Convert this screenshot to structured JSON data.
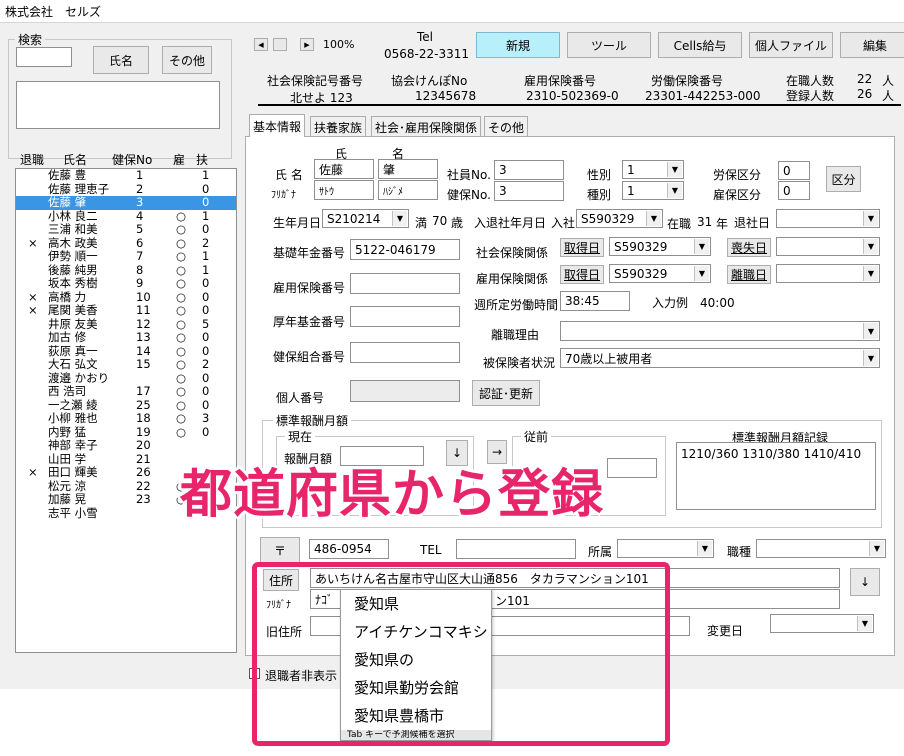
{
  "app_title": "株式会社　セルズ",
  "search": {
    "group_label": "検索",
    "name_button": "氏名",
    "other_button": "その他"
  },
  "list": {
    "headers": {
      "retired": "退職",
      "name": "氏名",
      "insurance_no": "健保No",
      "employed": "雇",
      "dependents": "扶"
    },
    "rows": [
      {
        "retired": "",
        "name": "佐藤 豊",
        "no": "1",
        "emp": "",
        "dep": "1"
      },
      {
        "retired": "",
        "name": "佐藤 理恵子",
        "no": "2",
        "emp": "",
        "dep": "0"
      },
      {
        "retired": "",
        "name": "佐藤 肇",
        "no": "3",
        "emp": "",
        "dep": "0",
        "selected": true
      },
      {
        "retired": "",
        "name": "小林 良二",
        "no": "4",
        "emp": "○",
        "dep": "1"
      },
      {
        "retired": "",
        "name": "三浦 和美",
        "no": "5",
        "emp": "○",
        "dep": "0"
      },
      {
        "retired": "×",
        "name": "高木 政美",
        "no": "6",
        "emp": "○",
        "dep": "2"
      },
      {
        "retired": "",
        "name": "伊勢 順一",
        "no": "7",
        "emp": "○",
        "dep": "1"
      },
      {
        "retired": "",
        "name": "後藤 純男",
        "no": "8",
        "emp": "○",
        "dep": "1"
      },
      {
        "retired": "",
        "name": "坂本 秀樹",
        "no": "9",
        "emp": "○",
        "dep": "0"
      },
      {
        "retired": "×",
        "name": "高橋 力",
        "no": "10",
        "emp": "○",
        "dep": "0"
      },
      {
        "retired": "×",
        "name": "尾関 美香",
        "no": "11",
        "emp": "○",
        "dep": "0"
      },
      {
        "retired": "",
        "name": "井原 友美",
        "no": "12",
        "emp": "○",
        "dep": "5"
      },
      {
        "retired": "",
        "name": "加古 修",
        "no": "13",
        "emp": "○",
        "dep": "0"
      },
      {
        "retired": "",
        "name": "荻原 真一",
        "no": "14",
        "emp": "○",
        "dep": "0"
      },
      {
        "retired": "",
        "name": "大石 弘文",
        "no": "15",
        "emp": "○",
        "dep": "2"
      },
      {
        "retired": "",
        "name": "渡邉 かおり",
        "no": "",
        "emp": "○",
        "dep": "0"
      },
      {
        "retired": "",
        "name": "西 浩司",
        "no": "17",
        "emp": "○",
        "dep": "0"
      },
      {
        "retired": "",
        "name": "一之瀬 綾",
        "no": "25",
        "emp": "○",
        "dep": "0"
      },
      {
        "retired": "",
        "name": "小柳 雅也",
        "no": "18",
        "emp": "○",
        "dep": "3"
      },
      {
        "retired": "",
        "name": "内野 猛",
        "no": "19",
        "emp": "○",
        "dep": "0"
      },
      {
        "retired": "",
        "name": "神部 幸子",
        "no": "20",
        "emp": "",
        "dep": ""
      },
      {
        "retired": "",
        "name": "山田 学",
        "no": "21",
        "emp": "",
        "dep": ""
      },
      {
        "retired": "×",
        "name": "田口 輝美",
        "no": "26",
        "emp": "",
        "dep": ""
      },
      {
        "retired": "",
        "name": "松元 涼",
        "no": "22",
        "emp": "○",
        "dep": ""
      },
      {
        "retired": "",
        "name": "加藤 晃",
        "no": "23",
        "emp": "○",
        "dep": "3"
      },
      {
        "retired": "",
        "name": "志平 小雪",
        "no": "",
        "emp": "",
        "dep": "0"
      }
    ]
  },
  "zoom": "100%",
  "tel_label": "Tel",
  "tel_number": "0568-22-3311",
  "toolbar": {
    "new": "新規",
    "tools": "ツール",
    "cells_pay": "Cells給与",
    "personal_file": "個人ファイル",
    "edit": "編集"
  },
  "company_info": {
    "social_ins_label": "社会保険記号番号",
    "social_ins_value": "北せよ 123",
    "kyokai_label": "協会けんぽNo",
    "kyokai_value": "12345678",
    "employment_label": "雇用保険番号",
    "employment_value": "2310-502369-0",
    "labor_label": "労働保険番号",
    "labor_value": "23301-442253-000",
    "enrolled_label": "在職人数",
    "enrolled_value": "22",
    "registered_label": "登録人数",
    "registered_value": "26",
    "unit": "人"
  },
  "tabs": [
    "基本情報",
    "扶養家族",
    "社会･雇用保険関係",
    "その他"
  ],
  "form": {
    "name_label": "氏 名",
    "kana_label": "ﾌﾘｶﾞﾅ",
    "sei_header": "氏",
    "mei_header": "名",
    "last_name": "佐藤",
    "first_name": "肇",
    "last_kana": "ｻﾄｳ",
    "first_kana": "ﾊｼﾞﾒ",
    "employee_no_label": "社員No.",
    "employee_no": "3",
    "health_no_label": "健保No.",
    "health_no": "3",
    "gender_label": "性別",
    "gender": "1",
    "type_label": "種別",
    "type": "1",
    "labor_class_label": "労保区分",
    "labor_class": "0",
    "emp_class_label": "雇保区分",
    "emp_class": "0",
    "class_button": "区分",
    "birthday_label": "生年月日",
    "birthday": "S210214",
    "age_prefix": "満",
    "age": "70",
    "age_suffix": "歳",
    "hire_label": "入退社年月日",
    "hire_in": "入社",
    "hire_date": "S590329",
    "tenure_prefix": "在職",
    "tenure": "31",
    "tenure_suffix": "年",
    "retire_label": "退社日",
    "pension_label": "基礎年金番号",
    "pension_value": "5122-046179",
    "social_label": "社会保険関係",
    "acquire_button": "取得日",
    "social_acquire": "S590329",
    "lose_button": "喪失日",
    "emp_ins_rel_label": "雇用保険関係",
    "emp_acquire": "S590329",
    "leave_button": "離職日",
    "emp_ins_no_label": "雇用保険番号",
    "weekly_hours_label": "週所定労働時間",
    "weekly_hours": "38:45",
    "input_example": "入力例　40:00",
    "welfare_label": "厚年基金番号",
    "leave_reason_label": "離職理由",
    "union_label": "健保組合番号",
    "insured_status_label": "被保険者状況",
    "insured_status": "70歳以上被用者",
    "my_number_label": "個人番号",
    "certify_button": "認証･更新"
  },
  "salary": {
    "group_label": "標準報酬月額",
    "current_label": "現在",
    "current_field_label": "報酬月額",
    "prev_label": "従前",
    "record_label": "標準報酬月額記録",
    "record_value": "1210/360 1310/380 1410/410",
    "down_arrow": "↓",
    "right_arrow": "→"
  },
  "address": {
    "postal_button": "〒",
    "postal": "486-0954",
    "tel_label": "TEL",
    "dept_label": "所属",
    "position_label": "職種",
    "address_button": "住所",
    "address_value": "あいちけん名古屋市守山区大山通856　タカラマンション101",
    "kana_label": "ﾌﾘｶﾞﾅ",
    "kana_value": "ﾅｺﾞ",
    "kana_suffix": "ン101",
    "old_label": "旧住所",
    "change_label": "変更日",
    "down_button": "↓"
  },
  "retired_hidden": "退職者非表示",
  "ime_suggestions": [
    "愛知県",
    "アイチケンコマキシ",
    "愛知県の",
    "愛知県勤労会館",
    "愛知県豊橋市"
  ],
  "ime_footer": "Tab キーで予測候補を選択",
  "overlay_caption": "都道府県から登録",
  "colors": {
    "highlight": "#e8256a",
    "selected_row": "#3a95e4",
    "new_button": "#b7f0fb"
  }
}
